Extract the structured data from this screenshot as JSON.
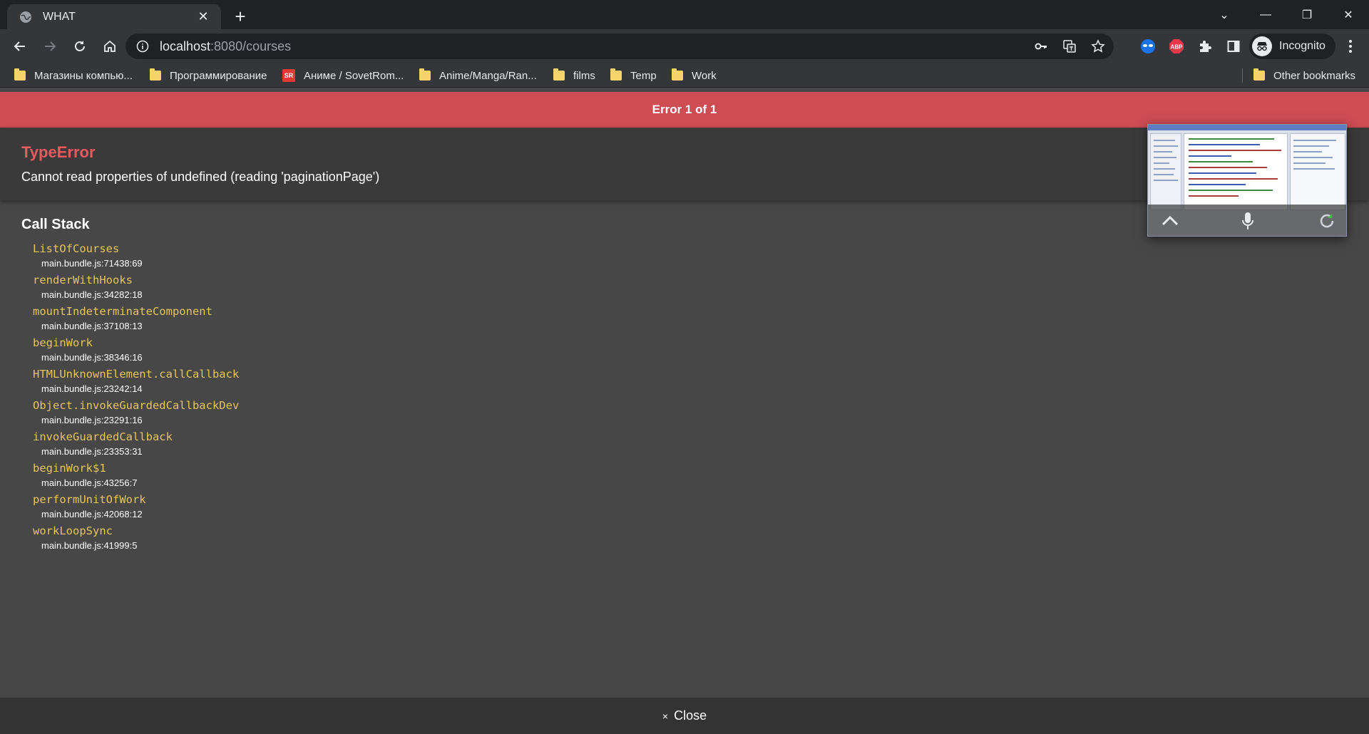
{
  "browser": {
    "tab": {
      "title": "WHAT",
      "close_label": "✕"
    },
    "new_tab_label": "+",
    "address": {
      "host": "localhost",
      "path": ":8080/courses"
    },
    "profile_label": "Incognito",
    "ext_abp_label": "ABP",
    "window_controls": {
      "collapse": "⌄",
      "minimize": "—",
      "restore": "❐",
      "close": "✕"
    }
  },
  "bookmarks": {
    "items": [
      {
        "label": "Магазины компью...",
        "icon": "folder-icon"
      },
      {
        "label": "Программирование",
        "icon": "folder-icon"
      },
      {
        "label": "Аниме / SovetRom...",
        "icon": "sovetromantica-icon",
        "icon_text": "SR"
      },
      {
        "label": "Anime/Manga/Ran...",
        "icon": "folder-icon"
      },
      {
        "label": "films",
        "icon": "folder-icon"
      },
      {
        "label": "Temp",
        "icon": "folder-icon"
      },
      {
        "label": "Work",
        "icon": "folder-icon"
      }
    ],
    "other": "Other bookmarks"
  },
  "overlay": {
    "header": "Error 1 of 1",
    "error_type": "TypeError",
    "error_message": "Cannot read properties of undefined (reading 'paginationPage')",
    "callstack_title": "Call Stack",
    "frames": [
      {
        "fn": "ListOfCourses",
        "loc": "main.bundle.js:71438:69"
      },
      {
        "fn": "renderWithHooks",
        "loc": "main.bundle.js:34282:18"
      },
      {
        "fn": "mountIndeterminateComponent",
        "loc": "main.bundle.js:37108:13"
      },
      {
        "fn": "beginWork",
        "loc": "main.bundle.js:38346:16"
      },
      {
        "fn": "HTMLUnknownElement.callCallback",
        "loc": "main.bundle.js:23242:14"
      },
      {
        "fn": "Object.invokeGuardedCallbackDev",
        "loc": "main.bundle.js:23291:16"
      },
      {
        "fn": "invokeGuardedCallback",
        "loc": "main.bundle.js:23353:31"
      },
      {
        "fn": "beginWork$1",
        "loc": "main.bundle.js:43256:7"
      },
      {
        "fn": "performUnitOfWork",
        "loc": "main.bundle.js:42068:12"
      },
      {
        "fn": "workLoopSync",
        "loc": "main.bundle.js:41999:5"
      }
    ],
    "close_icon": "×",
    "close_label": "Close"
  },
  "colors": {
    "error_header": "#cd4d53",
    "error_type": "#ea5a5f",
    "function_name": "#e6c55a"
  }
}
